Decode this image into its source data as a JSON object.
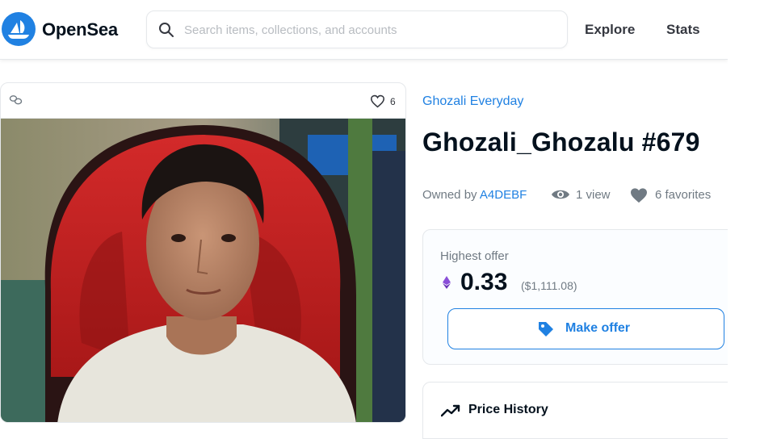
{
  "header": {
    "brand": "OpenSea",
    "search_placeholder": "Search items, collections, and accounts",
    "nav": [
      "Explore",
      "Stats"
    ]
  },
  "media": {
    "favorites_count": "6",
    "image_description_icon": "portrait-photo"
  },
  "item": {
    "collection": "Ghozali Everyday",
    "title": "Ghozali_Ghozalu #679",
    "owned_by_label": "Owned by ",
    "owner": "A4DEBF",
    "views": "1 view",
    "favorites": "6 favorites"
  },
  "offer": {
    "label": "Highest offer",
    "price": "0.33",
    "usd": "($1,111.08)",
    "button": "Make offer"
  },
  "price_history": {
    "label": "Price History"
  },
  "colors": {
    "accent": "#2081e2",
    "text": "#04111d",
    "muted": "#707a83",
    "eth": "#8a4fd8"
  }
}
